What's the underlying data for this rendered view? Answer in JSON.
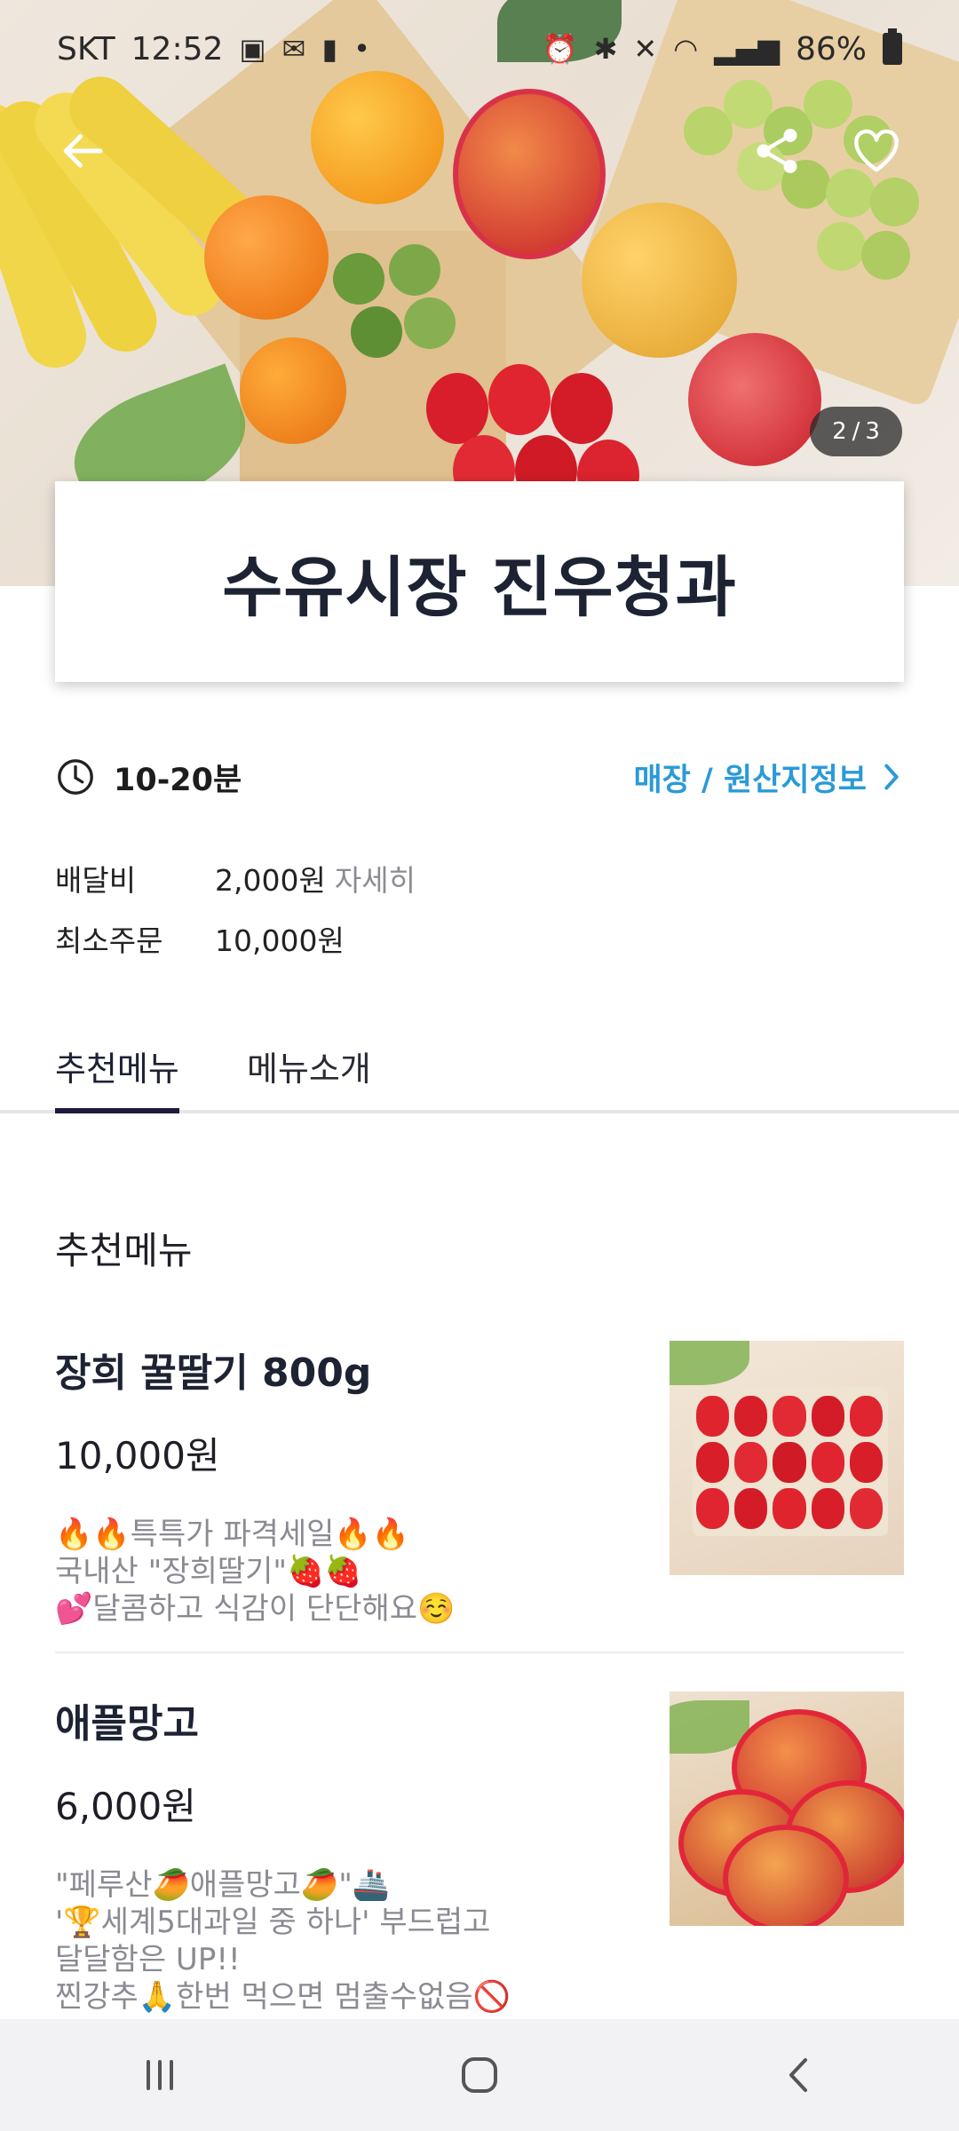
{
  "status_bar": {
    "carrier": "SKT",
    "time": "12:52",
    "battery": "86%"
  },
  "hero": {
    "pager_current": "2",
    "pager_sep": "/",
    "pager_total": "3"
  },
  "store": {
    "name": "수유시장 진우청과",
    "delivery_time": "10-20분",
    "info_link": "매장 / 원산지정보",
    "delivery_fee_label": "배달비",
    "delivery_fee_value": "2,000원",
    "delivery_fee_detail": "자세히",
    "min_order_label": "최소주문",
    "min_order_value": "10,000원"
  },
  "tabs": [
    {
      "label": "추천메뉴",
      "active": true
    },
    {
      "label": "메뉴소개",
      "active": false
    }
  ],
  "section_title": "추천메뉴",
  "menu_items": [
    {
      "name": "장희 꿀딸기 800g",
      "price": "10,000원",
      "desc": [
        "🔥🔥특특가 파격세일🔥🔥",
        "국내산 \"장희딸기\"🍓🍓",
        "💕달콤하고 식감이 단단해요☺️"
      ]
    },
    {
      "name": "애플망고",
      "price": "6,000원",
      "desc": [
        "\"페루산🥭애플망고🥭\"🚢",
        "'🏆세계5대과일 중 하나' 부드럽고",
        "달달함은 UP!!",
        "찐강추🙏한번 먹으면 멈출수없음🚫"
      ]
    }
  ]
}
